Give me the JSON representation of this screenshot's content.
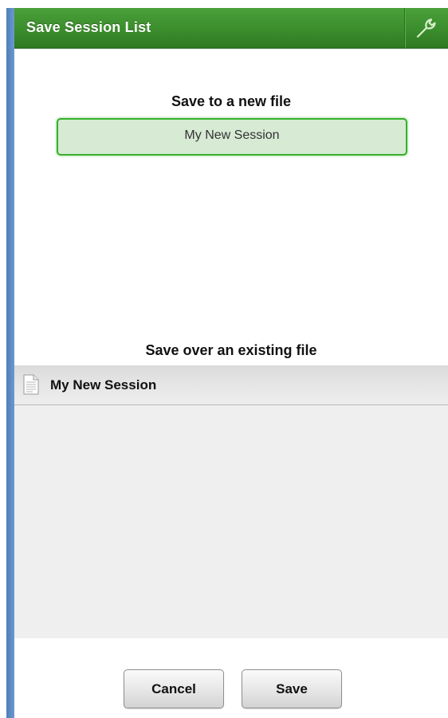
{
  "header": {
    "title": "Save Session List",
    "settings_icon": "wrench-icon"
  },
  "new_file": {
    "heading": "Save to a new file",
    "input_value": "My New Session"
  },
  "existing_file": {
    "heading": "Save over an existing file",
    "items": [
      {
        "label": "My New Session",
        "icon": "document-icon"
      }
    ]
  },
  "footer": {
    "cancel_label": "Cancel",
    "save_label": "Save"
  },
  "colors": {
    "header_green": "#3b8d2c",
    "input_border": "#38b02c",
    "input_fill": "#d6ead4",
    "rail_blue": "#4f7fb8",
    "list_bg": "#efefef"
  }
}
